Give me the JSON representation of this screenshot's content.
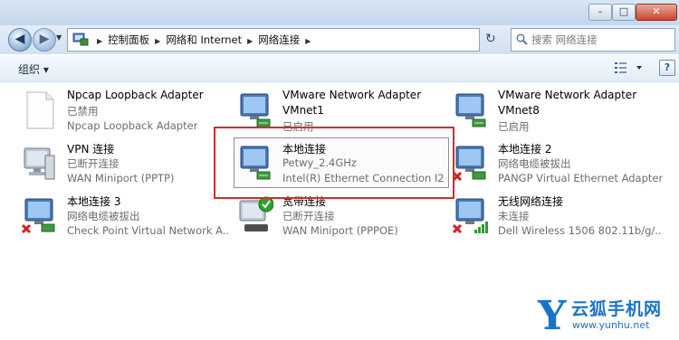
{
  "address": {
    "crumbs": [
      "控制面板",
      "网络和 Internet",
      "网络连接"
    ]
  },
  "search": {
    "placeholder": "搜索 网络连接"
  },
  "toolbar": {
    "organize_label": "组织 ▾"
  },
  "window": {
    "minimize": "–",
    "maximize": "□",
    "close": "✕"
  },
  "items": [
    {
      "name": "Npcap Loopback Adapter",
      "status": "已禁用",
      "device": "Npcap Loopback Adapter",
      "icon": "document-icon"
    },
    {
      "name": "VMware Network Adapter VMnet1",
      "name_line1": "VMware Network Adapter",
      "name_line2": "VMnet1",
      "status": "已启用",
      "icon": "network-monitor-icon"
    },
    {
      "name": "VMware Network Adapter VMnet8",
      "name_line1": "VMware Network Adapter",
      "name_line2": "VMnet8",
      "status": "已启用",
      "icon": "network-monitor-icon"
    },
    {
      "name": "VPN 连接",
      "status": "已断开连接",
      "device": "WAN Miniport (PPTP)",
      "icon": "vpn-computer-icon"
    },
    {
      "name": "本地连接",
      "status": "Petwy_2.4GHz",
      "device": "Intel(R) Ethernet Connection I2...",
      "icon": "network-monitor-icon"
    },
    {
      "name": "本地连接 2",
      "status": "网络电缆被拔出",
      "device": "PANGP Virtual Ethernet Adapter",
      "icon": "network-disconnected-icon"
    },
    {
      "name": "本地连接 3",
      "status": "网络电缆被拔出",
      "device": "Check Point Virtual Network A...",
      "icon": "network-disconnected-icon"
    },
    {
      "name": "宽带连接",
      "status": "已断开连接",
      "device": "WAN Miniport (PPPOE)",
      "icon": "broadband-icon"
    },
    {
      "name": "无线网络连接",
      "status": "未连接",
      "device": "Dell Wireless 1506 802.11b/g/...",
      "icon": "wireless-icon"
    }
  ],
  "watermark": {
    "letter": "Y",
    "title": "云狐手机网",
    "url": "www.yunhu.net"
  }
}
